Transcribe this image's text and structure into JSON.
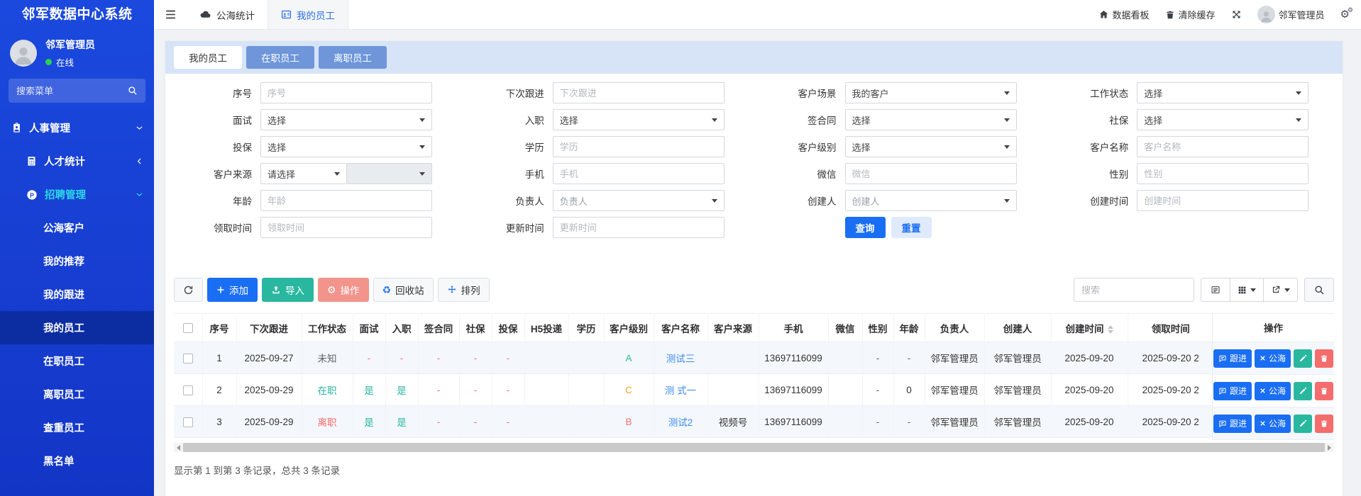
{
  "app": {
    "logo": "邻军数据中心系统"
  },
  "colors": {
    "sidebar_blue": "#1b49de",
    "sidebar_active": "#0c2da2",
    "active_parent_cyan": "#2bd9e8",
    "accent_blue": "#1a6ef4",
    "teal_green": "#2ab7a0",
    "salmon": "#f2948b",
    "danger_red": "#f56c6c",
    "orange": "#f5a524",
    "tabband_bg": "#d7e3f6",
    "inactive_tab_blue": "#6e96d9",
    "online_green": "#27d34f"
  },
  "icons": {
    "gear": "⚙",
    "recycle": "♻",
    "p_badge": "P"
  },
  "sidebar": {
    "user": {
      "name": "邻军管理员",
      "status": "在线"
    },
    "search_placeholder": "搜索菜单",
    "menu": [
      {
        "label": "人事管理"
      },
      {
        "label": "人才统计"
      },
      {
        "label": "招聘管理"
      },
      {
        "label": "公海客户"
      },
      {
        "label": "我的推荐"
      },
      {
        "label": "我的跟进"
      },
      {
        "label": "我的员工"
      },
      {
        "label": "在职员工"
      },
      {
        "label": "离职员工"
      },
      {
        "label": "查重员工"
      },
      {
        "label": "黑名单"
      }
    ]
  },
  "topnav": {
    "tabs": [
      {
        "label": "公海统计"
      },
      {
        "label": "我的员工"
      }
    ],
    "right": {
      "dashboard": "数据看板",
      "clear_cache": "清除缓存",
      "username": "邻军管理员"
    }
  },
  "tabs": [
    {
      "label": "我的员工"
    },
    {
      "label": "在职员工"
    },
    {
      "label": "离职员工"
    }
  ],
  "filter": {
    "xuhao": {
      "label": "序号",
      "placeholder": "序号"
    },
    "next_follow": {
      "label": "下次跟进",
      "placeholder": "下次跟进"
    },
    "scene": {
      "label": "客户场景",
      "value": "我的客户"
    },
    "work_status": {
      "label": "工作状态",
      "value": "选择"
    },
    "mianshi": {
      "label": "面试",
      "value": "选择"
    },
    "ruzhi": {
      "label": "入职",
      "value": "选择"
    },
    "qianhetong": {
      "label": "签合同",
      "value": "选择"
    },
    "shebao": {
      "label": "社保",
      "value": "选择"
    },
    "toubao": {
      "label": "投保",
      "value": "选择"
    },
    "xueli": {
      "label": "学历",
      "placeholder": "学历"
    },
    "level": {
      "label": "客户级别",
      "value": "选择"
    },
    "cname": {
      "label": "客户名称",
      "placeholder": "客户名称"
    },
    "source": {
      "label": "客户来源",
      "value": "请选择"
    },
    "phone": {
      "label": "手机",
      "placeholder": "手机"
    },
    "wechat": {
      "label": "微信",
      "placeholder": "微信"
    },
    "sex": {
      "label": "性别",
      "placeholder": "性别"
    },
    "age": {
      "label": "年龄",
      "placeholder": "年龄"
    },
    "owner": {
      "label": "负责人",
      "value": "负责人"
    },
    "creator": {
      "label": "创建人",
      "value": "创建人"
    },
    "ctime": {
      "label": "创建时间",
      "placeholder": "创建时间"
    },
    "ltime": {
      "label": "领取时间",
      "placeholder": "领取时间"
    },
    "utime": {
      "label": "更新时间",
      "placeholder": "更新时间"
    },
    "query": "查询",
    "reset": "重置"
  },
  "toolbar": {
    "add": "添加",
    "import": "导入",
    "operate": "操作",
    "recycle": "回收站",
    "arrange": "排列",
    "search_placeholder": "搜索"
  },
  "table": {
    "columns": [
      "序号",
      "下次跟进",
      "工作状态",
      "面试",
      "入职",
      "签合同",
      "社保",
      "投保",
      "H5投递",
      "学历",
      "客户级别",
      "客户名称",
      "客户来源",
      "手机",
      "微信",
      "性别",
      "年龄",
      "负责人",
      "创建人",
      "创建时间",
      "领取时间",
      "操作"
    ],
    "actions": {
      "follow": "跟进",
      "sea": "公海"
    },
    "rows": [
      {
        "xh": "1",
        "next": "2025-09-27",
        "status": "未知",
        "ms": "-",
        "rz": "-",
        "qht": "-",
        "sb": "-",
        "tb": "-",
        "h5": "",
        "xl": "",
        "level": "A",
        "name": "测试三",
        "source": "",
        "phone": "13697116099",
        "wx": "",
        "sex": "-",
        "age": "-",
        "owner": "邻军管理员",
        "creator": "邻军管理员",
        "ctime": "2025-09-20",
        "ltime": "2025-09-20 2"
      },
      {
        "xh": "2",
        "next": "2025-09-29",
        "status": "在职",
        "ms": "是",
        "rz": "是",
        "qht": "-",
        "sb": "-",
        "tb": "-",
        "h5": "",
        "xl": "",
        "level": "C",
        "name": "测 式一",
        "source": "",
        "phone": "13697116099",
        "wx": "",
        "sex": "-",
        "age": "0",
        "owner": "邻军管理员",
        "creator": "邻军管理员",
        "ctime": "2025-09-20",
        "ltime": "2025-09-20 2"
      },
      {
        "xh": "3",
        "next": "2025-09-29",
        "status": "离职",
        "ms": "是",
        "rz": "是",
        "qht": "-",
        "sb": "-",
        "tb": "-",
        "h5": "",
        "xl": "",
        "level": "B",
        "name": "测试2",
        "source": "视频号",
        "phone": "13697116099",
        "wx": "",
        "sex": "-",
        "age": "-",
        "owner": "邻军管理员",
        "creator": "邻军管理员",
        "ctime": "2025-09-20",
        "ltime": "2025-09-20 2"
      }
    ]
  },
  "footer": {
    "summary": "显示第 1 到第 3 条记录，总共 3 条记录"
  }
}
